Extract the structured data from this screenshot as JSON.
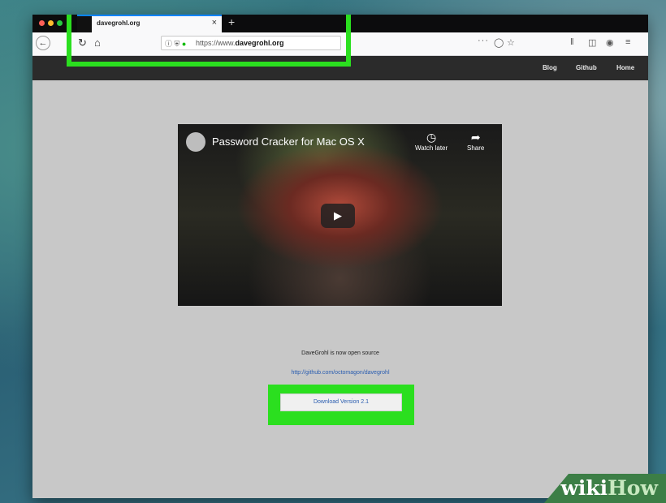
{
  "browser": {
    "tab": {
      "title": "davegrohl.org",
      "close_icon": "×"
    },
    "new_tab_icon": "+",
    "url": {
      "prefix": "https://www.",
      "domain": "davegrohl.org"
    },
    "page_actions": "···",
    "icons": {
      "back": "arrow-left-icon",
      "reload": "reload-icon",
      "home": "home-icon",
      "info": "info-icon",
      "tracking": "shield-icon",
      "lock": "lock-icon",
      "pocket": "pocket-icon",
      "bookmark": "star-icon",
      "library": "library-icon",
      "sidebar": "sidebar-icon",
      "account": "account-icon",
      "menu": "hamburger-menu-icon"
    }
  },
  "site": {
    "nav": [
      "Blog",
      "Github",
      "Home"
    ],
    "video": {
      "title": "Password Cracker for Mac OS X",
      "watch_later": "Watch later",
      "share": "Share"
    },
    "open_source_text": "DaveGrohl is now open source",
    "github_link": "http://github.com/octomagon/davegrohl",
    "download_label": "Download Version 2.1"
  },
  "watermark": {
    "wiki": "wiki",
    "how": "How"
  },
  "colors": {
    "highlight": "#2bdf1f",
    "link": "#2a5db0",
    "site_header": "#2b2b2b",
    "page_bg": "#c8c8c8"
  }
}
